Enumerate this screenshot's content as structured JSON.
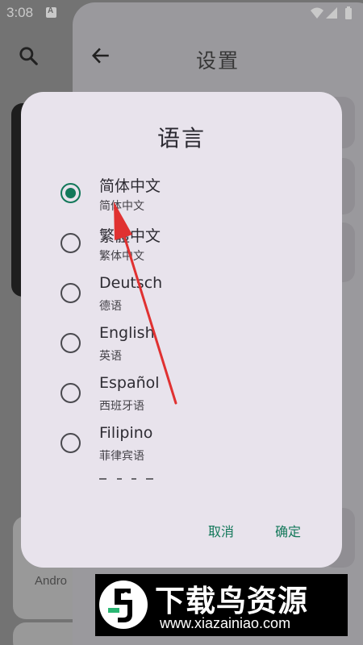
{
  "status_bar": {
    "time": "3:08"
  },
  "settings": {
    "title": "设置"
  },
  "background": {
    "android_text": "Andro"
  },
  "dialog": {
    "title": "语言",
    "options": [
      {
        "label": "简体中文",
        "sublabel": "简体中文",
        "selected": true
      },
      {
        "label": "繁體中文",
        "sublabel": "繁体中文",
        "selected": false
      },
      {
        "label": "Deutsch",
        "sublabel": "德语",
        "selected": false
      },
      {
        "label": "English",
        "sublabel": "英语",
        "selected": false
      },
      {
        "label": "Español",
        "sublabel": "西班牙语",
        "selected": false
      },
      {
        "label": "Filipino",
        "sublabel": "菲律宾语",
        "selected": false
      }
    ],
    "cancel_label": "取消",
    "ok_label": "确定"
  },
  "watermark": {
    "title": "下载鸟资源",
    "url": "www.xiazainiao.com"
  },
  "colors": {
    "accent": "#13785a",
    "dialog_bg": "#e8e3ec",
    "annotation_arrow": "#e03131"
  },
  "icons": [
    "search-icon",
    "back-arrow-icon",
    "wifi-icon",
    "signal-icon",
    "battery-icon"
  ]
}
